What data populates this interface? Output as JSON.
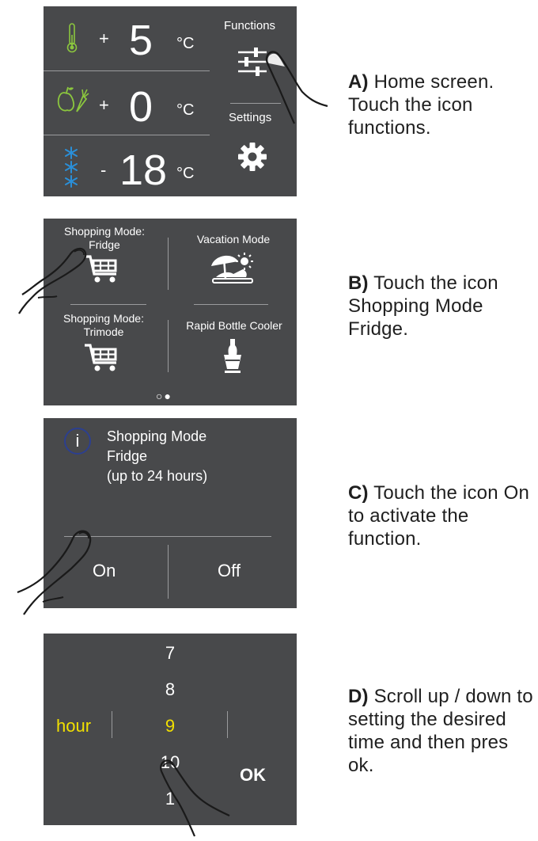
{
  "panel_a": {
    "rows": [
      {
        "icon": "thermometer-icon",
        "sign": "+",
        "value": "5",
        "unit": "°C"
      },
      {
        "icon": "fruit-vegetable-icon",
        "sign": "+",
        "value": "0",
        "unit": "°C"
      },
      {
        "icon": "snowflake-icon",
        "sign": "-",
        "value": "18",
        "unit": "°C"
      }
    ],
    "functions_label": "Functions",
    "settings_label": "Settings",
    "caption_step": "A)",
    "caption_text": " Home screen. Touch the icon functions."
  },
  "panel_b": {
    "tiles": [
      {
        "label": "Shopping Mode: Fridge",
        "icon": "shopping-cart-icon"
      },
      {
        "label": "Vacation Mode",
        "icon": "vacation-icon"
      },
      {
        "label": "Shopping Mode: Trimode",
        "icon": "shopping-cart-icon"
      },
      {
        "label": "Rapid Bottle Cooler",
        "icon": "bottle-cooler-icon"
      }
    ],
    "page_dots": [
      "○",
      "●"
    ],
    "caption_step": "B)",
    "caption_text": " Touch the icon Shopping Mode Fridge."
  },
  "panel_c": {
    "info_icon": "i",
    "message_line1": "Shopping Mode",
    "message_line2": "Fridge",
    "message_line3": "(up to 24 hours)",
    "on_label": "On",
    "off_label": "Off",
    "caption_step": "C)",
    "caption_text": " Touch the icon On to activate the function."
  },
  "panel_d": {
    "unit_label": "hour",
    "values": [
      "7",
      "8",
      "9",
      "10",
      "1"
    ],
    "selected_index": 2,
    "ok_label": "OK",
    "caption_step": "D)",
    "caption_text": " Scroll up / down to setting the desired time and then pres ok."
  },
  "colors": {
    "screen_bg": "#48494b",
    "divider": "#9a9b9d",
    "highlight_yellow": "#f2e000",
    "fresh_green": "#8bc63e",
    "freezer_blue": "#2a8fd8",
    "info_ring_blue": "#2c3f8f"
  }
}
